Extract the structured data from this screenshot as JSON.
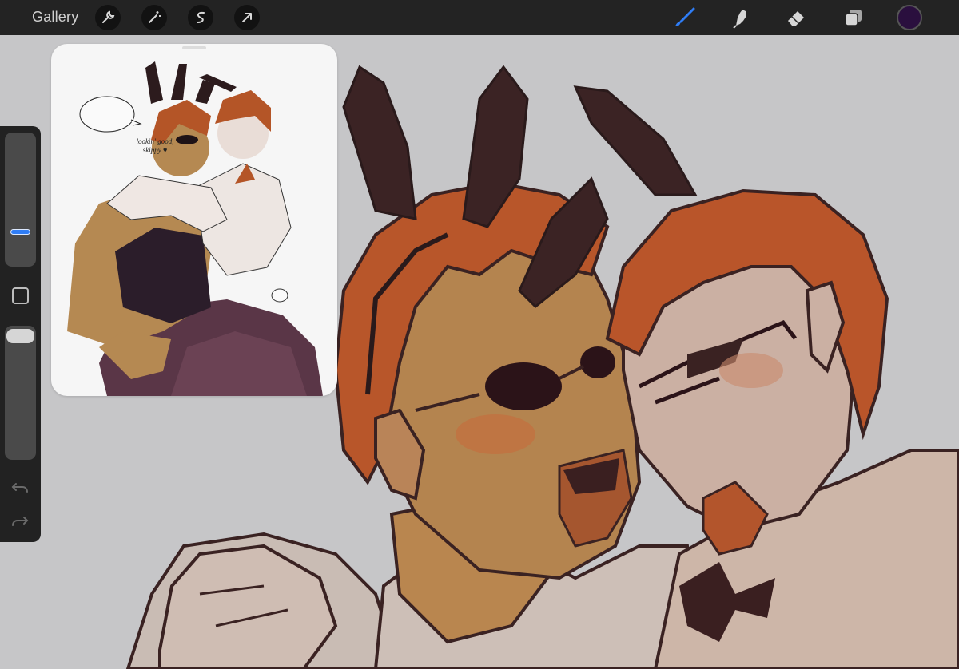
{
  "topbar": {
    "gallery_label": "Gallery",
    "left_tools": [
      "wrench-icon",
      "magic-wand-icon",
      "selection-icon",
      "transform-arrow-icon"
    ],
    "right_tools": [
      "brush-icon",
      "smudge-icon",
      "eraser-icon",
      "layers-icon"
    ],
    "active_tool": "brush-icon",
    "active_color": "#2a0f3e",
    "accent_color": "#2f7df6"
  },
  "sidebar": {
    "controls": [
      "brush-size-slider",
      "modify-button",
      "opacity-slider",
      "undo-icon",
      "redo-icon"
    ]
  },
  "reference": {
    "speech_line1": "lookin' good,",
    "speech_line2": "skippy ♥"
  }
}
